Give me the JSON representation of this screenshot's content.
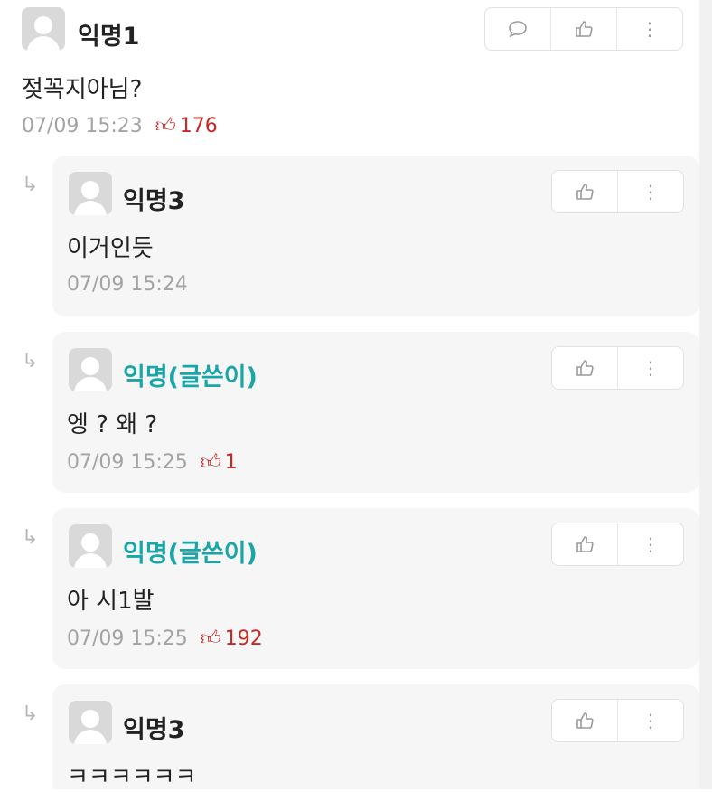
{
  "comment": {
    "author": "익명1",
    "text": "젖꼭지아님?",
    "time": "07/09 15:23",
    "likes": "176"
  },
  "replies": [
    {
      "author": "익명3",
      "text": "이거인듯",
      "time": "07/09 15:24",
      "likes": "",
      "is_writer": false
    },
    {
      "author": "익명(글쓴이)",
      "text": "엥 ? 왜 ?",
      "time": "07/09 15:25",
      "likes": "1",
      "is_writer": true
    },
    {
      "author": "익명(글쓴이)",
      "text": "아 시1발",
      "time": "07/09 15:25",
      "likes": "192",
      "is_writer": true
    },
    {
      "author": "익명3",
      "text": "ㅋㅋㅋㅋㅋㅋ",
      "time": "",
      "likes": "",
      "is_writer": false
    }
  ],
  "icons": {
    "reply": "speech-bubble-icon",
    "like": "thumbs-up-icon",
    "more": "vertical-dots-icon",
    "reply_arrow": "reply-arrow-icon"
  },
  "colors": {
    "writer_name": "#1aa6a8",
    "like_count": "#c62828",
    "meta_text": "#a3a3a3",
    "reply_bg": "#f6f6f6"
  }
}
